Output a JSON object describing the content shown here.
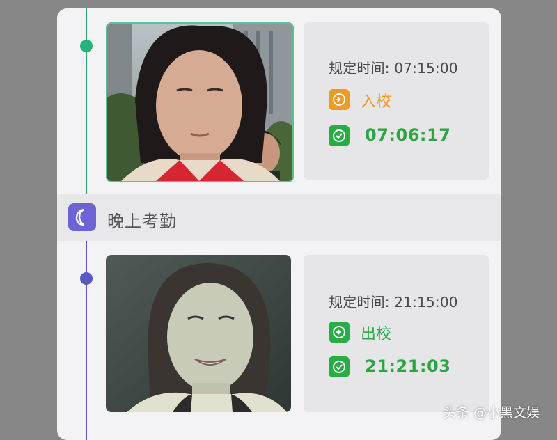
{
  "colors": {
    "accent_green": "#27ad43",
    "accent_orange": "#f09a26",
    "accent_purple": "#6d63d4",
    "dot_green": "#26b27b",
    "dot_blue": "#5a56c7"
  },
  "records": [
    {
      "rule_time": "规定时间: 07:15:00",
      "type_label": "入校",
      "type_icon": "enter-school-icon",
      "type_color": "#f09a26",
      "status_icon": "check-icon",
      "actual_time": "07:06:17",
      "photo": "student-photo-morning"
    },
    {
      "rule_time": "规定时间: 21:15:00",
      "type_label": "出校",
      "type_icon": "exit-school-icon",
      "type_color": "#27ad43",
      "status_icon": "check-icon",
      "actual_time": "21:21:03",
      "photo": "student-photo-evening"
    }
  ],
  "section": {
    "title": "晚上考勤",
    "icon": "moon-icon"
  },
  "watermark": "头条 @小黑文娱"
}
